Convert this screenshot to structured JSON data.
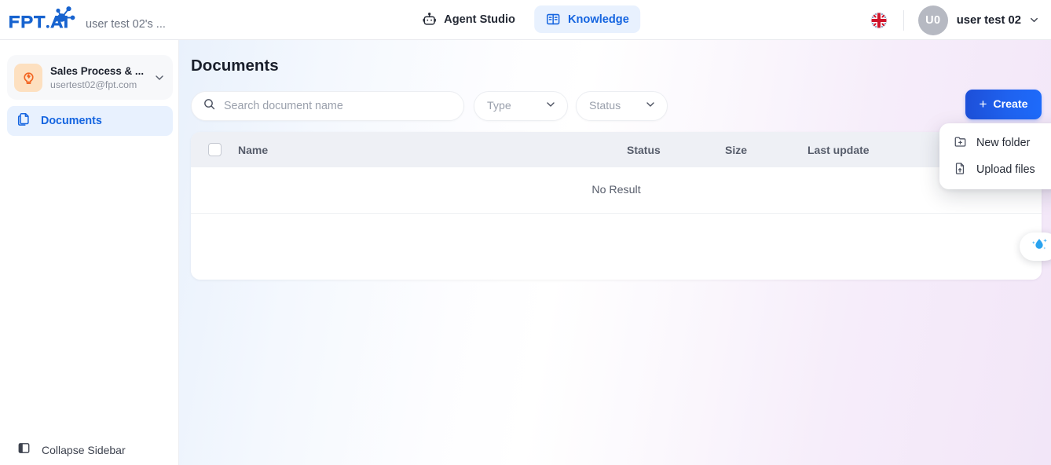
{
  "header": {
    "logo_alt": "FPT.AI",
    "workspace_label": "user test 02's ...",
    "nav": [
      {
        "label": "Agent Studio",
        "icon": "robot-icon",
        "active": false
      },
      {
        "label": "Knowledge",
        "icon": "book-icon",
        "active": true
      }
    ],
    "language_icon": "uk-flag-icon",
    "avatar_initials": "U0",
    "user_name": "user test 02"
  },
  "sidebar": {
    "project": {
      "icon": "lightbulb-icon",
      "title": "Sales Process & ...",
      "email": "usertest02@fpt.com",
      "caret_icon": "chevron-down-icon"
    },
    "items": [
      {
        "label": "Documents",
        "icon": "documents-icon",
        "active": true
      }
    ],
    "collapse": {
      "label": "Collapse Sidebar",
      "icon": "panel-collapse-icon"
    }
  },
  "main": {
    "title": "Documents",
    "search": {
      "placeholder": "Search document name",
      "value": "",
      "icon": "search-icon"
    },
    "filters": [
      {
        "name": "type",
        "label": "Type",
        "caret_icon": "chevron-down-icon"
      },
      {
        "name": "status",
        "label": "Status",
        "caret_icon": "chevron-down-icon"
      }
    ],
    "create_button": {
      "label": "Create",
      "plus": "+"
    },
    "create_menu": [
      {
        "label": "New folder",
        "icon": "folder-plus-icon"
      },
      {
        "label": "Upload files",
        "icon": "file-upload-icon"
      }
    ],
    "table": {
      "columns": [
        "Name",
        "Status",
        "Size",
        "Last update"
      ],
      "rows": [],
      "empty_text": "No Result"
    },
    "assistant": {
      "icon": "ai-droplet-icon"
    }
  },
  "colors": {
    "accent_blue": "#1565e0",
    "create_gradient_from": "#1d4fd8",
    "create_gradient_to": "#1e6bfb",
    "active_pill": "#e8f1fe",
    "project_icon_bg": "#fde0c0",
    "project_icon_fg": "#f26522",
    "table_header_bg": "#eef0f5",
    "muted_text": "#9aa0ac"
  }
}
